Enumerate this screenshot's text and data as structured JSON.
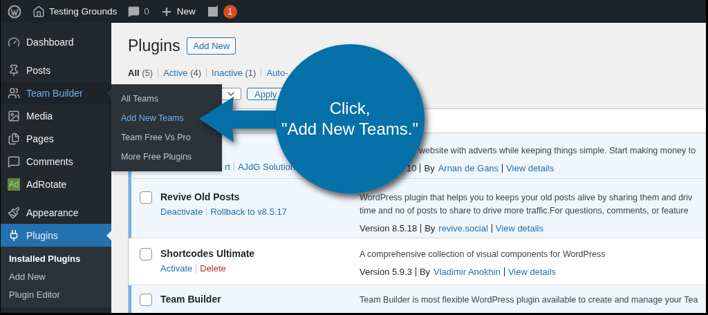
{
  "admin_bar": {
    "site_name": "Testing Grounds",
    "comments_count": "0",
    "new_label": "New",
    "notification_count": "1"
  },
  "sidebar": {
    "items": [
      {
        "label": "Dashboard",
        "selected": false,
        "open": false,
        "separator_before": false
      },
      {
        "label": "Posts",
        "selected": false,
        "open": false,
        "separator_before": true
      },
      {
        "label": "Team Builder",
        "selected": false,
        "open": true,
        "separator_before": false
      },
      {
        "label": "Media",
        "selected": false,
        "open": false,
        "separator_before": false
      },
      {
        "label": "Pages",
        "selected": false,
        "open": false,
        "separator_before": false
      },
      {
        "label": "Comments",
        "selected": false,
        "open": false,
        "separator_before": false
      },
      {
        "label": "AdRotate",
        "badge_text": "Ad",
        "selected": false,
        "open": false,
        "separator_before": false
      },
      {
        "label": "Appearance",
        "selected": false,
        "open": false,
        "separator_before": true
      },
      {
        "label": "Plugins",
        "selected": true,
        "open": false,
        "separator_before": false,
        "children": [
          {
            "label": "Installed Plugins",
            "selected": true
          },
          {
            "label": "Add New",
            "selected": false
          },
          {
            "label": "Plugin Editor",
            "selected": false
          }
        ]
      }
    ]
  },
  "flyout": {
    "items": [
      {
        "label": "All Teams",
        "selected": false
      },
      {
        "label": "Add New Teams",
        "selected": true
      },
      {
        "label": "Team Free Vs Pro",
        "selected": false
      },
      {
        "label": "More Free Plugins",
        "selected": false
      }
    ]
  },
  "page": {
    "title": "Plugins",
    "add_new": "Add New",
    "filters": [
      {
        "label": "All",
        "count": "(5)",
        "selected": true
      },
      {
        "label": "Active",
        "count": "(4)",
        "selected": false
      },
      {
        "label": "Inactive",
        "count": "(1)",
        "selected": false
      },
      {
        "label": "Auto-",
        "selected": false
      }
    ],
    "apply": "Apply"
  },
  "plugins": [
    {
      "active": true,
      "actions": [
        {
          "label": "rt",
          "kind": "link"
        },
        {
          "label": "AJdG Solution",
          "kind": "link"
        }
      ],
      "description": [
        "website with adverts while keeping things simple. Start making money to"
      ],
      "version": "10",
      "by": "By",
      "author": "Arnan de Gans",
      "details": "View details"
    },
    {
      "name": "Revive Old Posts",
      "active": true,
      "actions": [
        {
          "label": "Deactivate",
          "kind": "link"
        },
        {
          "label": "Rollback to v8.5.17",
          "kind": "link"
        }
      ],
      "description": [
        "WordPress plugin that helps you to keeps your old posts alive by sharing them and driv",
        "time and no of posts to share to drive more traffic.For questions, comments, or feature"
      ],
      "version": "Version 8.5.18",
      "by": "By",
      "author": "revive.social",
      "details": "View details"
    },
    {
      "name": "Shortcodes Ultimate",
      "active": false,
      "actions": [
        {
          "label": "Activate",
          "kind": "link"
        },
        {
          "label": "Delete",
          "kind": "danger"
        }
      ],
      "description": [
        "A comprehensive collection of visual components for WordPress"
      ],
      "version": "Version 5.9.3",
      "by": "By",
      "author": "Vladimir Anokhin",
      "details": "View details"
    },
    {
      "name": "Team Builder",
      "active": true,
      "description": [
        "Team Builder is most flexible WordPress plugin available to create and manage your Tea"
      ]
    }
  ],
  "callout": {
    "lines": [
      "Click,",
      "\"Add New Teams.\""
    ]
  }
}
